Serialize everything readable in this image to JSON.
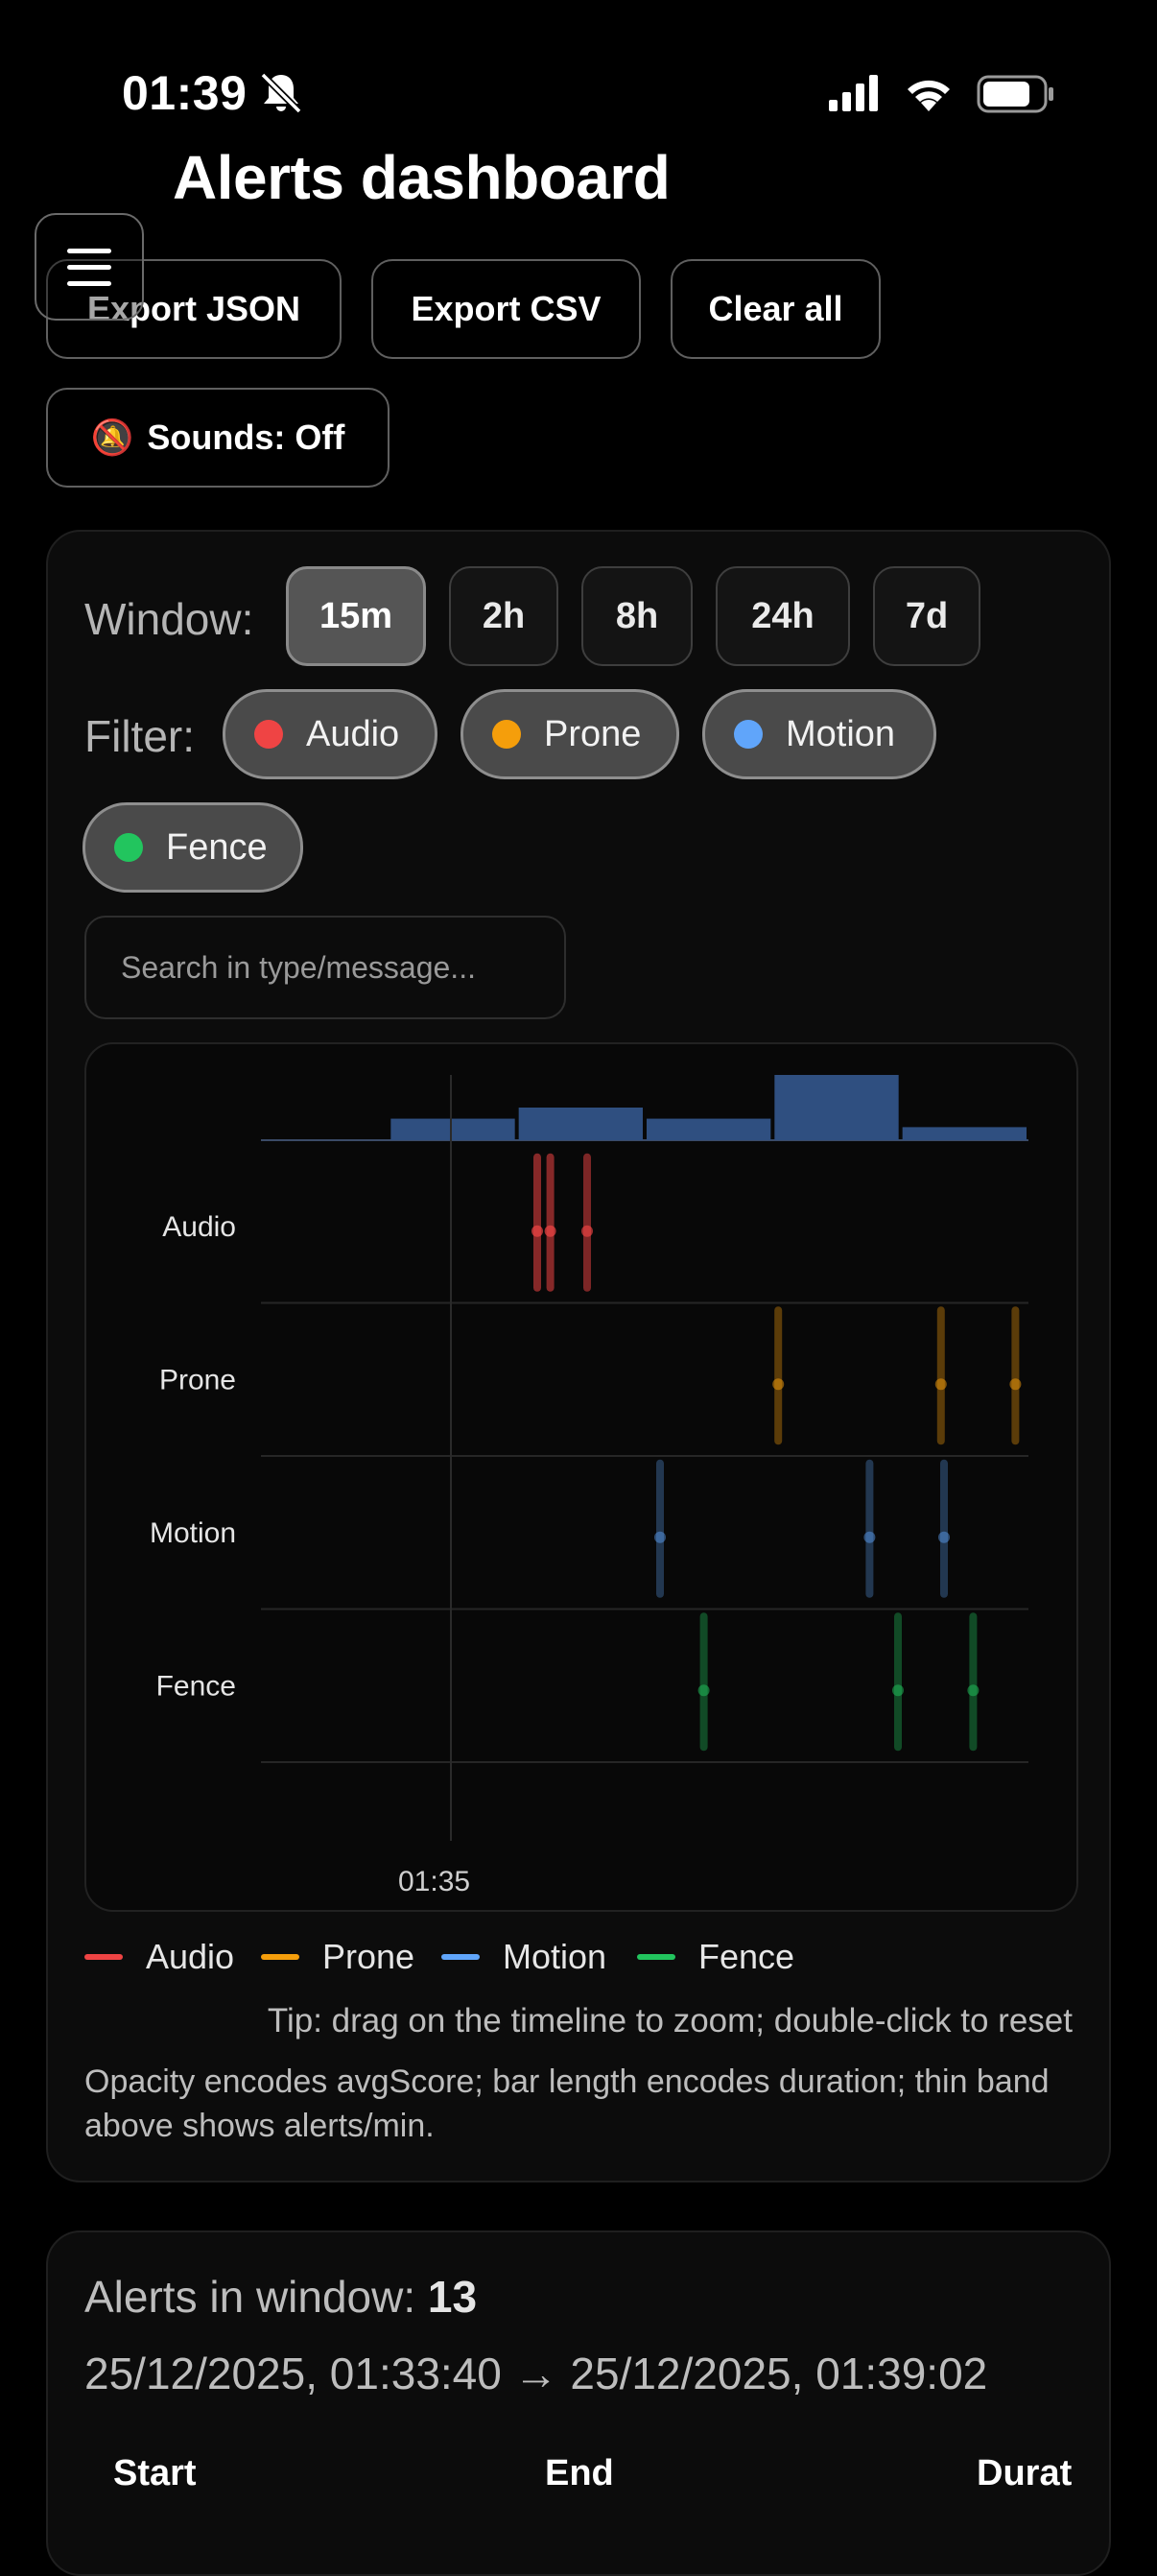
{
  "status_bar": {
    "time": "01:39",
    "icons": [
      "bell-slash-icon",
      "cellular-signal-icon",
      "wifi-icon",
      "battery-icon"
    ]
  },
  "header": {
    "title": "Alerts dashboard",
    "menu_icon": "hamburger-menu-icon"
  },
  "toolbar": {
    "export_json": "Export JSON",
    "export_csv": "Export CSV",
    "clear_all": "Clear all",
    "sounds_icon": "🔕",
    "sounds_label": "Sounds: Off"
  },
  "controls": {
    "window_label": "Window:",
    "window_options": [
      "15m",
      "2h",
      "8h",
      "24h",
      "7d"
    ],
    "window_selected": "15m",
    "filter_label": "Filter:",
    "filters": [
      {
        "label": "Audio",
        "color": "#ef4444",
        "active": true
      },
      {
        "label": "Prone",
        "color": "#f59e0b",
        "active": true
      },
      {
        "label": "Motion",
        "color": "#60a5fa",
        "active": true
      },
      {
        "label": "Fence",
        "color": "#22c55e",
        "active": true
      }
    ],
    "search_placeholder": "Search in type/message..."
  },
  "chart_data": {
    "type": "timeline",
    "x_tick_labels": [
      "01:35"
    ],
    "rate_band": {
      "description_source": "alerts/min",
      "bin_values": [
        0,
        0.33,
        0.5,
        0.33,
        1.0,
        0.2
      ]
    },
    "rows": [
      "Audio",
      "Prone",
      "Motion",
      "Fence"
    ],
    "series": [
      {
        "name": "Audio",
        "color": "#ef4444",
        "events": [
          {
            "t": 0.36,
            "opacity": 0.55
          },
          {
            "t": 0.377,
            "opacity": 0.55
          },
          {
            "t": 0.425,
            "opacity": 0.5
          }
        ]
      },
      {
        "name": "Prone",
        "color": "#f59e0b",
        "events": [
          {
            "t": 0.674,
            "opacity": 0.35
          },
          {
            "t": 0.886,
            "opacity": 0.35
          },
          {
            "t": 0.983,
            "opacity": 0.35
          }
        ]
      },
      {
        "name": "Motion",
        "color": "#60a5fa",
        "events": [
          {
            "t": 0.52,
            "opacity": 0.3
          },
          {
            "t": 0.793,
            "opacity": 0.3
          },
          {
            "t": 0.89,
            "opacity": 0.3
          }
        ]
      },
      {
        "name": "Fence",
        "color": "#22c55e",
        "events": [
          {
            "t": 0.577,
            "opacity": 0.35
          },
          {
            "t": 0.83,
            "opacity": 0.35
          },
          {
            "t": 0.928,
            "opacity": 0.35
          }
        ]
      }
    ],
    "legend": [
      "Audio",
      "Prone",
      "Motion",
      "Fence"
    ],
    "grid": true
  },
  "hints": {
    "tip": "Tip: drag on the timeline to zoom; double-click to reset",
    "note": "Opacity encodes avgScore; bar length encodes duration; thin band above shows alerts/min."
  },
  "summary": {
    "count_label": "Alerts in window:",
    "count": "13",
    "range": "25/12/2025, 01:33:40 → 25/12/2025, 01:39:02"
  },
  "table": {
    "headers": [
      "Start",
      "End",
      "Durat"
    ]
  }
}
